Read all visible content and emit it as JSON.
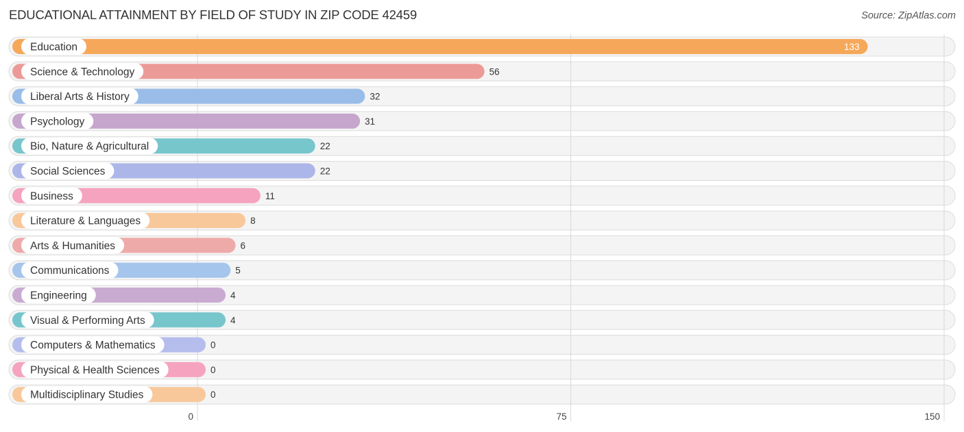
{
  "header": {
    "title": "EDUCATIONAL ATTAINMENT BY FIELD OF STUDY IN ZIP CODE 42459",
    "source": "Source: ZipAtlas.com"
  },
  "chart_data": {
    "type": "bar",
    "orientation": "horizontal",
    "title": "EDUCATIONAL ATTAINMENT BY FIELD OF STUDY IN ZIP CODE 42459",
    "xlabel": "",
    "ylabel": "",
    "xlim": [
      0,
      150
    ],
    "xticks": [
      0,
      75,
      150
    ],
    "xtick_labels": [
      "0",
      "75",
      "150"
    ],
    "grid": true,
    "legend": "none",
    "categories": [
      "Education",
      "Science & Technology",
      "Liberal Arts & History",
      "Psychology",
      "Bio, Nature & Agricultural",
      "Social Sciences",
      "Business",
      "Literature & Languages",
      "Arts & Humanities",
      "Communications",
      "Engineering",
      "Visual & Performing Arts",
      "Computers & Mathematics",
      "Physical & Health Sciences",
      "Multidisciplinary Studies"
    ],
    "values": [
      133,
      56,
      32,
      31,
      22,
      22,
      11,
      8,
      6,
      5,
      4,
      4,
      0,
      0,
      0
    ],
    "value_labels": [
      "133",
      "56",
      "32",
      "31",
      "22",
      "22",
      "11",
      "8",
      "6",
      "5",
      "4",
      "4",
      "0",
      "0",
      "0"
    ],
    "colors": [
      "#f6a85a",
      "#ec9a98",
      "#99bde8",
      "#c6a6cc",
      "#77c6cc",
      "#adb6e8",
      "#f5a3bf",
      "#f8c89b",
      "#eeaaa9",
      "#a5c5ec",
      "#c9abd2",
      "#77c6cc",
      "#b4bdec",
      "#f5a3bf",
      "#f8c89b"
    ]
  }
}
